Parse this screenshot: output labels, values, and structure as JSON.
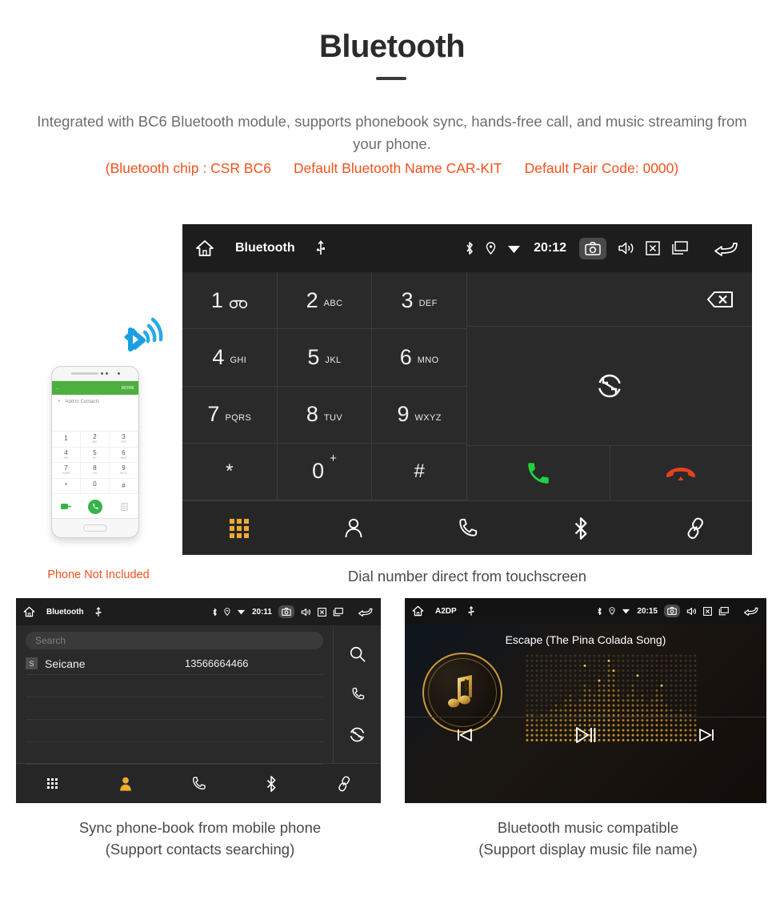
{
  "header": {
    "title": "Bluetooth",
    "intro": "Integrated with BC6 Bluetooth module, supports phonebook sync, hands-free call, and music streaming from your phone.",
    "spec_chip": "(Bluetooth chip : CSR BC6",
    "spec_name": "Default Bluetooth Name CAR-KIT",
    "spec_pair": "Default Pair Code: 0000)",
    "accent_color": "#f4511e",
    "body_color": "#6e6e6e"
  },
  "phone_mockup": {
    "appbar_back": "←",
    "appbar_more": "MORE",
    "add_to_contacts": "Add to Contacts",
    "plus": "+",
    "keys": [
      {
        "num": "1",
        "ltr": ""
      },
      {
        "num": "2",
        "ltr": "ABC"
      },
      {
        "num": "3",
        "ltr": "DEF"
      },
      {
        "num": "4",
        "ltr": "GHI"
      },
      {
        "num": "5",
        "ltr": "JKL"
      },
      {
        "num": "6",
        "ltr": "MNO"
      },
      {
        "num": "7",
        "ltr": "PQRS"
      },
      {
        "num": "8",
        "ltr": "TUV"
      },
      {
        "num": "9",
        "ltr": "WXYZ"
      },
      {
        "num": "*",
        "ltr": ""
      },
      {
        "num": "0",
        "ltr": "+"
      },
      {
        "num": "#",
        "ltr": ""
      }
    ],
    "caption": "Phone Not Included",
    "caption_color": "#f4511e",
    "appbar_color": "#4caf3f"
  },
  "main_unit": {
    "statusbar": {
      "home_icon": "home-icon",
      "title": "Bluetooth",
      "usb_icon": "usb-icon",
      "bluetooth_icon": "bluetooth-icon",
      "location_icon": "location-icon",
      "wifi_icon": "wifi-icon",
      "time": "20:12",
      "camera_icon": "camera-icon",
      "volume_icon": "volume-icon",
      "close_icon": "close-box-icon",
      "recents_icon": "recent-apps-icon",
      "back_icon": "back-icon"
    },
    "keypad": [
      {
        "num": "1",
        "ltr": "",
        "icon": "voicemail-icon"
      },
      {
        "num": "2",
        "ltr": "ABC",
        "icon": ""
      },
      {
        "num": "3",
        "ltr": "DEF",
        "icon": ""
      },
      {
        "num": "4",
        "ltr": "GHI",
        "icon": ""
      },
      {
        "num": "5",
        "ltr": "JKL",
        "icon": ""
      },
      {
        "num": "6",
        "ltr": "MNO",
        "icon": ""
      },
      {
        "num": "7",
        "ltr": "PQRS",
        "icon": ""
      },
      {
        "num": "8",
        "ltr": "TUV",
        "icon": ""
      },
      {
        "num": "9",
        "ltr": "WXYZ",
        "icon": ""
      },
      {
        "num": "*",
        "ltr": "",
        "icon": ""
      },
      {
        "num": "0",
        "ltr": "+",
        "icon": ""
      },
      {
        "num": "#",
        "ltr": "",
        "icon": ""
      }
    ],
    "number_display": "",
    "backspace_icon": "backspace-icon",
    "sync_icon": "sync-icon",
    "call_icon": "call-icon",
    "hangup_icon": "hangup-icon",
    "call_color": "#1fd13d",
    "hangup_color": "#e8401f",
    "navbar": [
      {
        "name": "keypad",
        "icon": "keypad-grid-icon",
        "active": true
      },
      {
        "name": "contacts",
        "icon": "contact-person-icon",
        "active": false
      },
      {
        "name": "call-log",
        "icon": "phone-handset-icon",
        "active": false
      },
      {
        "name": "bluetooth",
        "icon": "bluetooth-icon",
        "active": false
      },
      {
        "name": "pair-link",
        "icon": "link-icon",
        "active": false
      }
    ],
    "active_color": "#f0ab2e",
    "caption": "Dial number direct from touchscreen"
  },
  "phonebook_unit": {
    "statusbar": {
      "title": "Bluetooth",
      "time": "20:11"
    },
    "search_placeholder": "Search",
    "columns": [
      "name",
      "number"
    ],
    "contacts": [
      {
        "badge": "S",
        "name": "Seicane",
        "number": "13566664466"
      }
    ],
    "empty_rows": 4,
    "side_actions": [
      {
        "name": "search",
        "icon": "search-icon"
      },
      {
        "name": "dial",
        "icon": "phone-handset-icon"
      },
      {
        "name": "sync",
        "icon": "sync-icon"
      }
    ],
    "navbar": [
      {
        "name": "keypad",
        "icon": "keypad-grid-icon",
        "active": false
      },
      {
        "name": "contacts",
        "icon": "contact-person-icon",
        "active": true
      },
      {
        "name": "call-log",
        "icon": "phone-handset-icon",
        "active": false
      },
      {
        "name": "bluetooth",
        "icon": "bluetooth-icon",
        "active": false
      },
      {
        "name": "pair-link",
        "icon": "link-icon",
        "active": false
      }
    ],
    "caption_line1": "Sync phone-book from mobile phone",
    "caption_line2": "(Support contacts searching)"
  },
  "music_unit": {
    "statusbar": {
      "title": "A2DP",
      "time": "20:15"
    },
    "song_title": "Escape (The Pina Colada Song)",
    "album_icon": "music-note-bluetooth-icon",
    "equalizer": "dotted-equalizer-visualizer",
    "controls": [
      {
        "name": "previous",
        "icon": "skip-previous-icon"
      },
      {
        "name": "play-pause",
        "icon": "play-pause-icon"
      },
      {
        "name": "next",
        "icon": "skip-next-icon"
      }
    ],
    "gold_color": "#c99a3c",
    "caption_line1": "Bluetooth music compatible",
    "caption_line2": "(Support display music file name)"
  }
}
